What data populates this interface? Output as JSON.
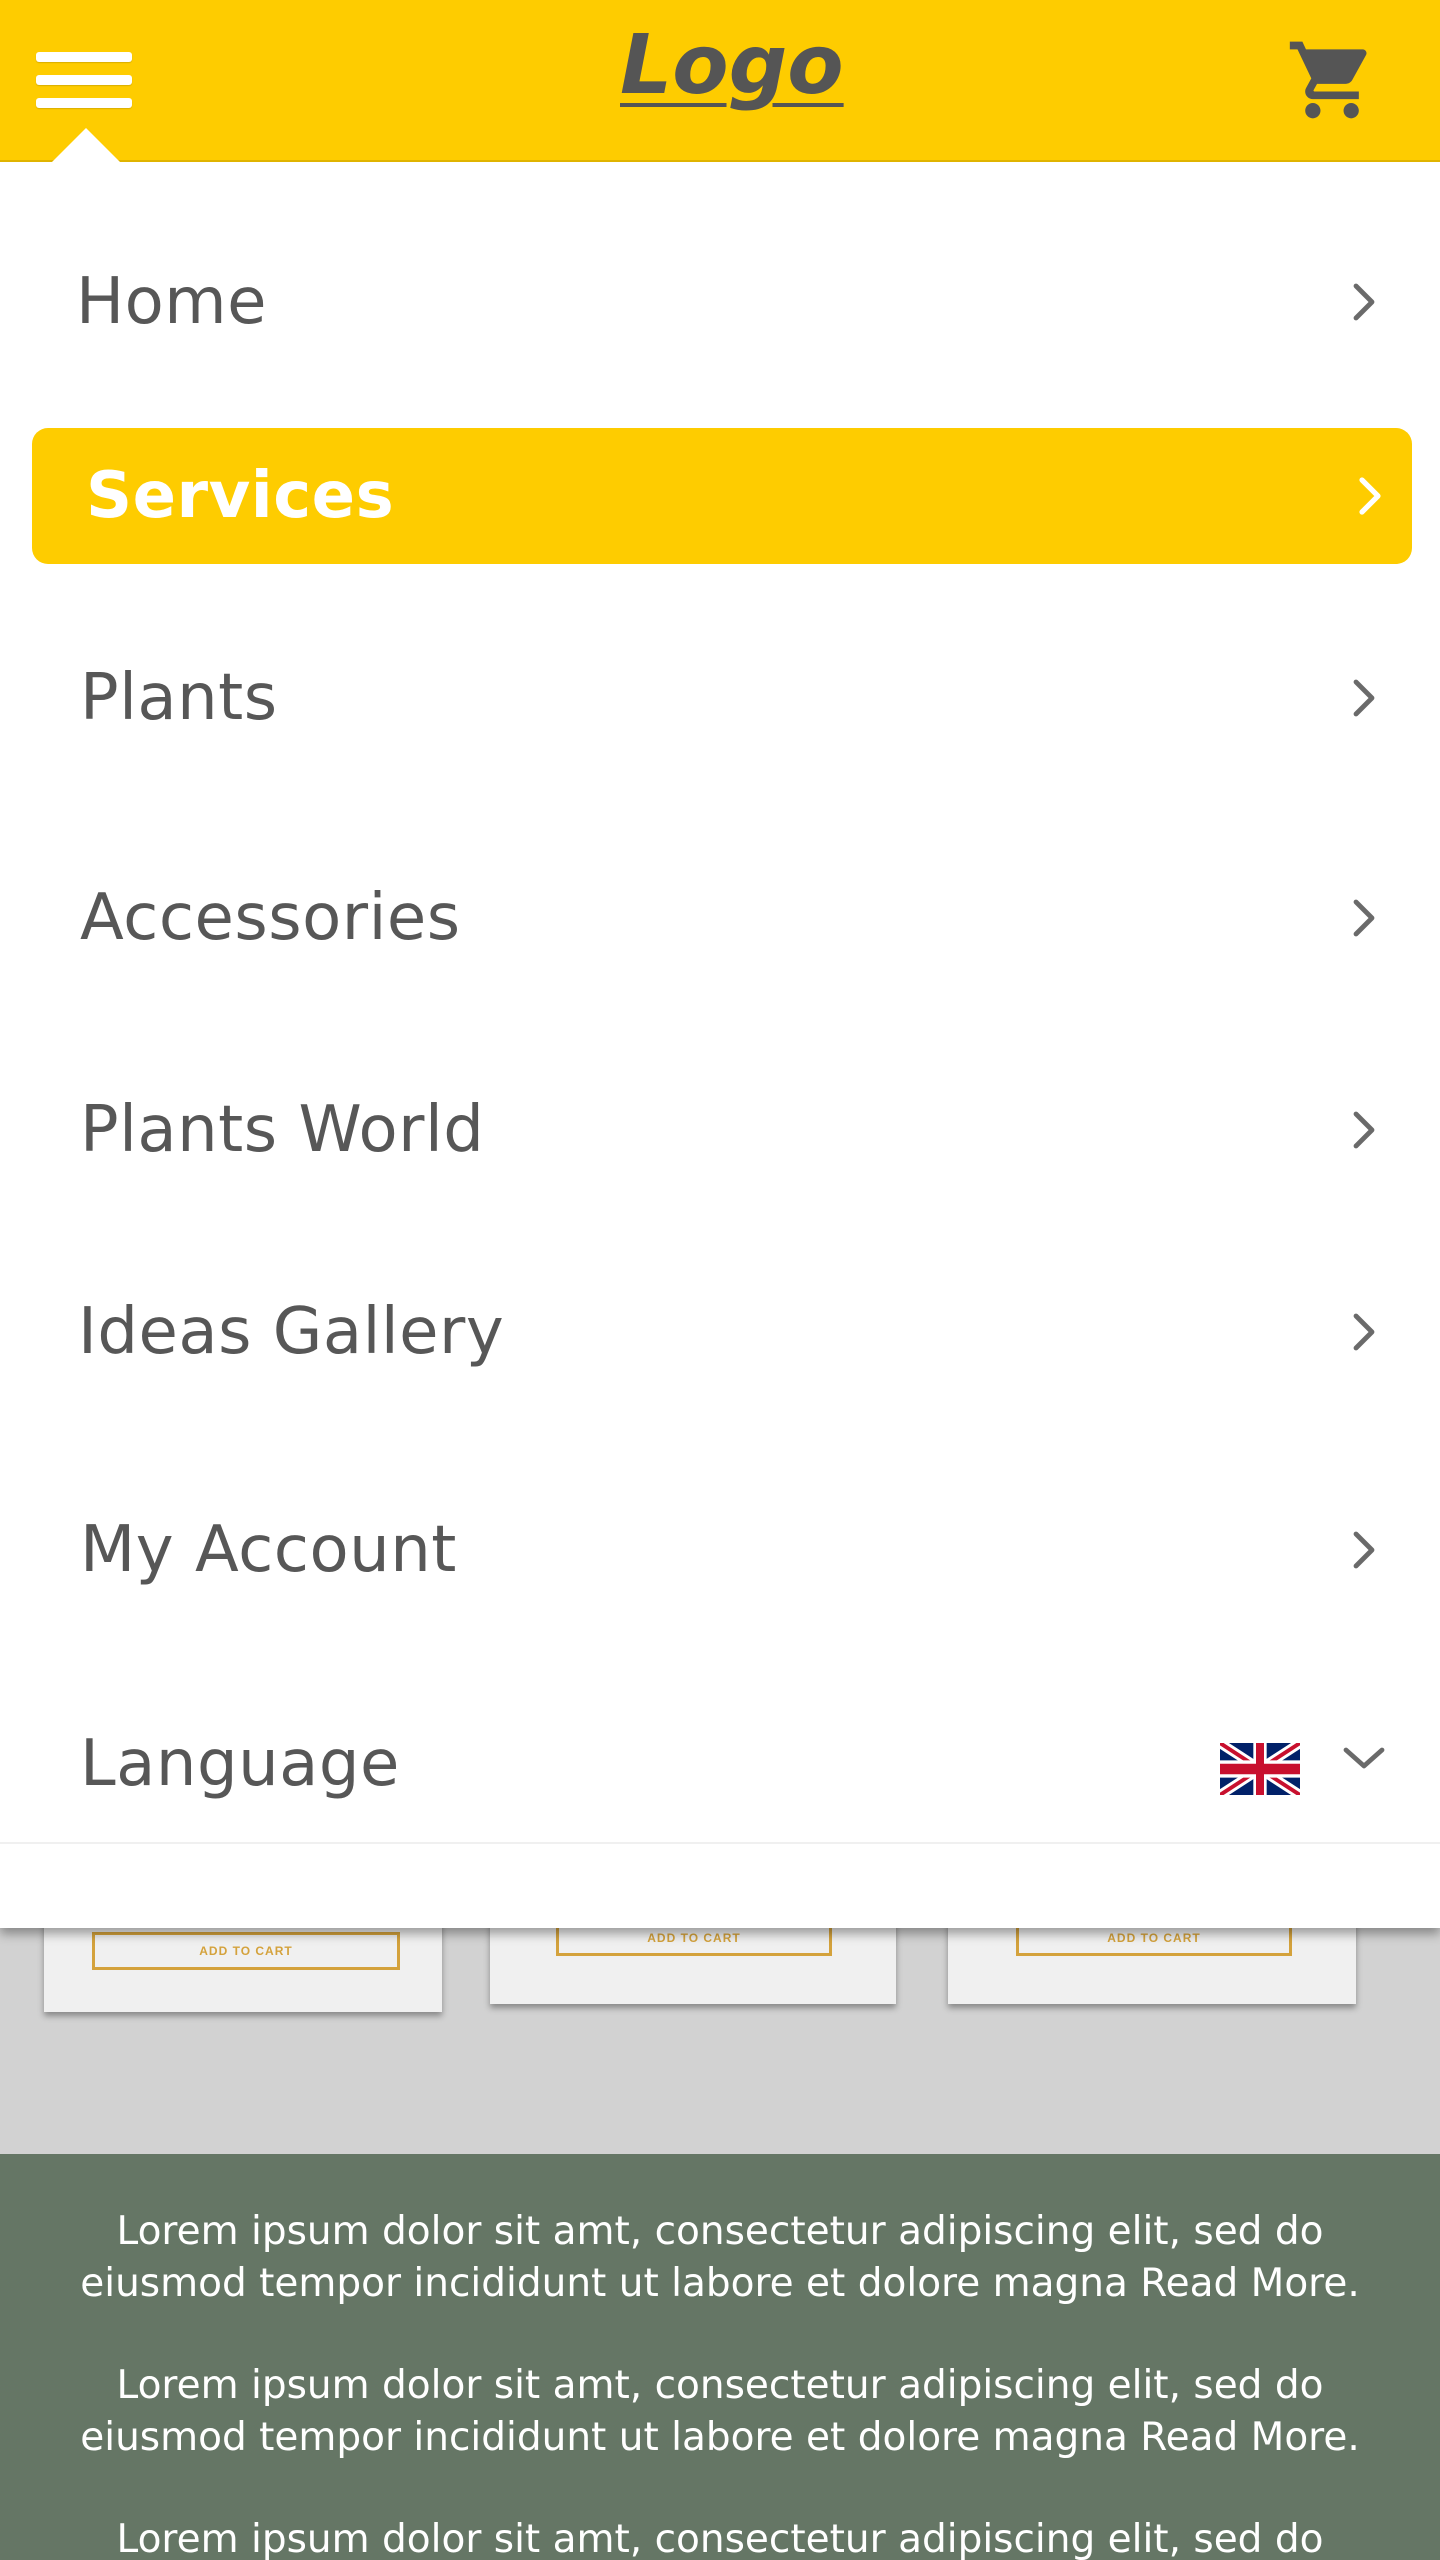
{
  "header": {
    "logo": "Logo",
    "menu_icon": "hamburger-icon",
    "cart_icon": "cart-icon",
    "brand_color": "#fecc00"
  },
  "menu": {
    "items": [
      {
        "label": "Home",
        "icon": "chevron-right-icon"
      },
      {
        "label": "Services",
        "icon": "chevron-right-icon",
        "active": true
      },
      {
        "label": "Plants",
        "icon": "chevron-right-icon"
      },
      {
        "label": "Accessories",
        "icon": "chevron-right-icon"
      },
      {
        "label": "Plants World",
        "icon": "chevron-right-icon"
      },
      {
        "label": "Ideas Gallery",
        "icon": "chevron-right-icon"
      },
      {
        "label": "My Account",
        "icon": "chevron-right-icon"
      },
      {
        "label": "Language",
        "icon": "chevron-down-icon",
        "flag": "uk-flag-icon"
      }
    ]
  },
  "products": {
    "add_to_cart": "ADD TO CART"
  },
  "footer": {
    "paragraphs": [
      "Lorem ipsum dolor sit amt, consectetur adipiscing elit, sed do eiusmod tempor incididunt ut labore et dolore magna Read More.",
      "Lorem ipsum dolor sit amt, consectetur adipiscing elit, sed do eiusmod tempor incididunt ut labore et dolore magna Read More.",
      "Lorem ipsum dolor sit amt, consectetur adipiscing elit, sed do eiusmod"
    ],
    "background": "#657665"
  }
}
